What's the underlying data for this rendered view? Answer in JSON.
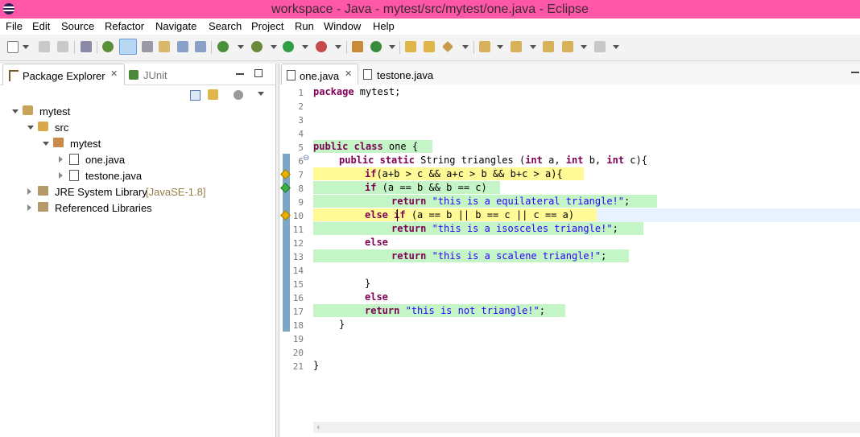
{
  "window": {
    "title": "workspace - Java - mytest/src/mytest/one.java - Eclipse"
  },
  "menu": [
    "File",
    "Edit",
    "Source",
    "Refactor",
    "Navigate",
    "Search",
    "Project",
    "Run",
    "Window",
    "Help"
  ],
  "left_panel": {
    "tabs": [
      {
        "label": "Package Explorer",
        "icon": "package-explorer-icon",
        "active": true
      },
      {
        "label": "JUnit",
        "icon": "junit-icon",
        "active": false
      }
    ],
    "tree": [
      {
        "label": "mytest",
        "icon": "java-project-icon",
        "expanded": true
      },
      {
        "label": "src",
        "icon": "source-folder-icon",
        "expanded": true
      },
      {
        "label": "mytest",
        "icon": "package-icon",
        "expanded": true
      },
      {
        "label": "one.java",
        "icon": "java-file-icon",
        "expanded": false
      },
      {
        "label": "testone.java",
        "icon": "java-file-icon",
        "expanded": false
      },
      {
        "label": "JRE System Library",
        "suffix": "[JavaSE-1.8]",
        "icon": "library-icon",
        "expanded": false
      },
      {
        "label": "Referenced Libraries",
        "icon": "library-icon",
        "expanded": false
      }
    ]
  },
  "editor": {
    "tabs": [
      {
        "label": "one.java",
        "active": true
      },
      {
        "label": "testone.java",
        "active": false
      }
    ],
    "line_numbers": [
      "1",
      "2",
      "3",
      "4",
      "5",
      "6",
      "7",
      "8",
      "9",
      "10",
      "11",
      "12",
      "13",
      "14",
      "15",
      "16",
      "17",
      "18",
      "19",
      "20",
      "21"
    ],
    "fold_marker": "⊖",
    "coverage_colors": {
      "full": "#c4f5c6",
      "partial": "#fffa95",
      "marker_full": "#3cb043",
      "marker_partial": "#e8b100"
    },
    "code": {
      "l1_kw": "package",
      "l1_rest": " mytest;",
      "l5_kw": "public class",
      "l5_rest": " one {",
      "l6_kw1": "public static",
      "l6_mid1": " String triangles (",
      "l6_kw2": "int",
      "l6_mid2": " a, ",
      "l6_kw3": "int",
      "l6_mid3": " b, ",
      "l6_kw4": "int",
      "l6_mid4": " c){",
      "l7_kw": "if",
      "l7_rest": "(a+b > c && a+c > b && b+c > a){",
      "l8_kw": "if",
      "l8_rest": " (a == b && b == c)",
      "l9_kw": "return",
      "l9_str": "\"this is a equilateral triangle!\"",
      "l9_end": ";",
      "l10_kw1": "else",
      "l10_kw2": "if",
      "l10_rest": " (a == b || b == c || c == a)",
      "l11_kw": "return",
      "l11_str": "\"this is a isosceles triangle!\"",
      "l11_end": ";",
      "l12_kw": "else",
      "l13_kw": "return",
      "l13_str": "\"this is a scalene triangle!\"",
      "l13_end": ";",
      "l15": "}",
      "l16_kw": "else",
      "l17_kw": "return",
      "l17_str": "\"this is not triangle!\"",
      "l17_end": ";",
      "l18": "}",
      "l21": "}"
    }
  }
}
